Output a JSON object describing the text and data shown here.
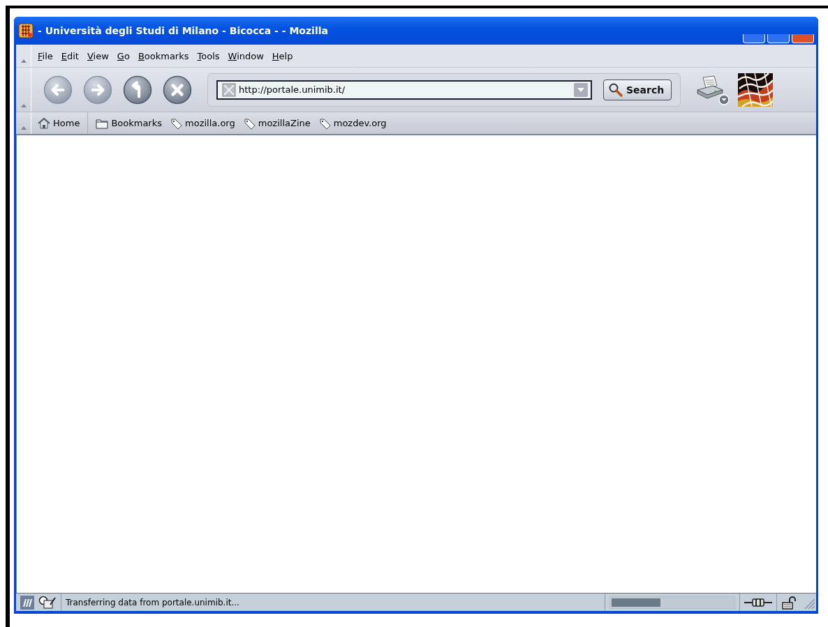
{
  "window": {
    "title": "- Università degli Studi di Milano - Bicocca - - Mozilla"
  },
  "menu": [
    "File",
    "Edit",
    "View",
    "Go",
    "Bookmarks",
    "Tools",
    "Window",
    "Help"
  ],
  "navigation": [
    {
      "kind": "back",
      "disabled": true
    },
    {
      "kind": "forward",
      "disabled": true
    },
    {
      "kind": "reload",
      "disabled": false
    },
    {
      "kind": "stop",
      "disabled": false
    }
  ],
  "address": {
    "value": "http://portale.unimib.it/"
  },
  "search_button": "Search",
  "bookmarks": [
    {
      "kind": "home",
      "label": "Home"
    },
    {
      "kind": "folder",
      "label": "Bookmarks"
    },
    {
      "kind": "link",
      "label": "mozilla.org"
    },
    {
      "kind": "link",
      "label": "mozillaZine"
    },
    {
      "kind": "link",
      "label": "mozdev.org"
    }
  ],
  "status": {
    "text": "Transferring data from portale.unimib.it...",
    "progress": {
      "level": 0.4
    },
    "secure": false
  }
}
